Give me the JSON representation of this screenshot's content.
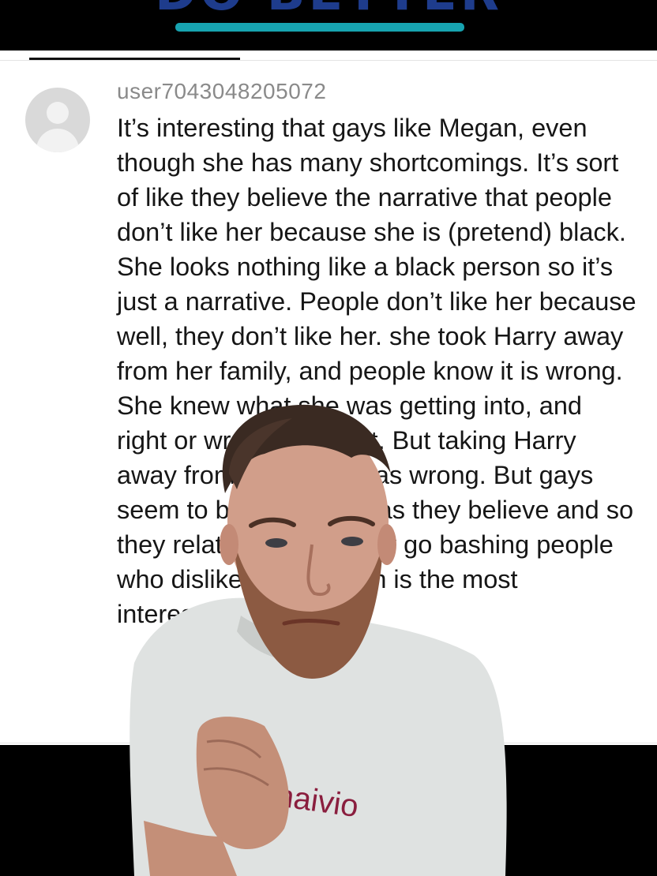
{
  "banner": {
    "title": "DO BETTER"
  },
  "comment": {
    "username": "user7043048205072",
    "text": "It’s interesting that gays like Megan, even though she has many shortcomings. It’s sort of like they believe the narrative that people don’t like her because she is (pretend) black. She looks nothing like a black person so it’s just a narrative. People don’t like her because well, they don’t like her. she took Harry away from her family, and people know it is wrong. She knew what she was getting into, and right or wrong a lot of it. But taking Harry away from his family was wrong. But gays seem to be oppressed as they believe and so they relate. So here they go bashing people who dislike them, which is the most interesting."
  },
  "presenter": {
    "shirt_text": "naivio"
  },
  "colors": {
    "banner_title": "#1e3c8c",
    "banner_underline": "#17a3b0",
    "username": "#8a8a8a",
    "comment_text": "#161616",
    "avatar_bg": "#d9d9d9"
  }
}
